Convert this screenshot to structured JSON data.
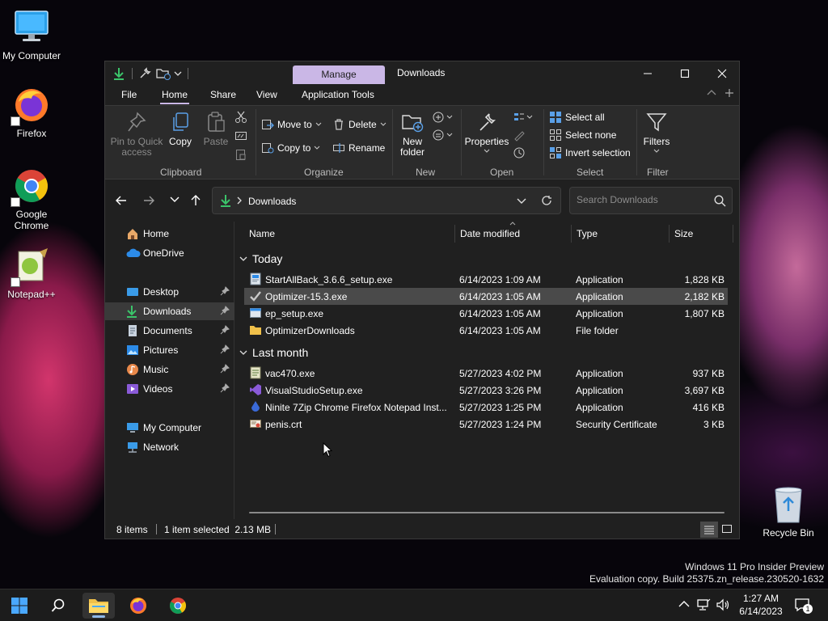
{
  "desktop": {
    "icons": [
      {
        "label": "My Computer"
      },
      {
        "label": "Firefox"
      },
      {
        "label": "Google Chrome"
      },
      {
        "label": "Notepad++"
      },
      {
        "label": "Recycle Bin"
      }
    ],
    "watermark_line1": "Windows 11 Pro Insider Preview",
    "watermark_line2": "Evaluation copy. Build 25375.zn_release.230520-1632"
  },
  "window": {
    "context_tab": "Manage",
    "title": "Downloads",
    "menu": [
      "File",
      "Home",
      "Share",
      "View",
      "Application Tools"
    ],
    "active_menu": "Home",
    "ribbon": {
      "pin_label_1": "Pin to Quick",
      "pin_label_2": "access",
      "copy": "Copy",
      "paste": "Paste",
      "clipboard": "Clipboard",
      "move_to": "Move to",
      "copy_to": "Copy to",
      "delete": "Delete",
      "rename": "Rename",
      "organize": "Organize",
      "new_folder_1": "New",
      "new_folder_2": "folder",
      "new": "New",
      "properties": "Properties",
      "open": "Open",
      "select_all": "Select all",
      "select_none": "Select none",
      "invert_selection": "Invert selection",
      "select": "Select",
      "filters": "Filters",
      "filter": "Filter"
    },
    "address": {
      "location": "Downloads",
      "search_placeholder": "Search Downloads"
    },
    "nav": [
      {
        "label": "Home"
      },
      {
        "label": "OneDrive"
      },
      {
        "label": "Desktop"
      },
      {
        "label": "Downloads"
      },
      {
        "label": "Documents"
      },
      {
        "label": "Pictures"
      },
      {
        "label": "Music"
      },
      {
        "label": "Videos"
      },
      {
        "label": "My Computer"
      },
      {
        "label": "Network"
      }
    ],
    "columns": {
      "name": "Name",
      "date": "Date modified",
      "type": "Type",
      "size": "Size"
    },
    "groups": {
      "today": "Today",
      "last_month": "Last month"
    },
    "files": [
      {
        "name": "StartAllBack_3.6.6_setup.exe",
        "date": "6/14/2023 1:09 AM",
        "type": "Application",
        "size": "1,828 KB"
      },
      {
        "name": "Optimizer-15.3.exe",
        "date": "6/14/2023 1:05 AM",
        "type": "Application",
        "size": "2,182 KB"
      },
      {
        "name": "ep_setup.exe",
        "date": "6/14/2023 1:05 AM",
        "type": "Application",
        "size": "1,807 KB"
      },
      {
        "name": "OptimizerDownloads",
        "date": "6/14/2023 1:05 AM",
        "type": "File folder",
        "size": ""
      },
      {
        "name": "vac470.exe",
        "date": "5/27/2023 4:02 PM",
        "type": "Application",
        "size": "937 KB"
      },
      {
        "name": "VisualStudioSetup.exe",
        "date": "5/27/2023 3:26 PM",
        "type": "Application",
        "size": "3,697 KB"
      },
      {
        "name": "Ninite 7Zip Chrome Firefox Notepad Inst...",
        "date": "5/27/2023 1:25 PM",
        "type": "Application",
        "size": "416 KB"
      },
      {
        "name": "penis.crt",
        "date": "5/27/2023 1:24 PM",
        "type": "Security Certificate",
        "size": "3 KB"
      }
    ],
    "status": {
      "count": "8 items",
      "selection": "1 item selected  2.13 MB"
    }
  },
  "taskbar": {
    "time": "1:27 AM",
    "date": "6/14/2023",
    "notifications": "1"
  },
  "colors": {
    "accent": "#cab7e6",
    "window_bg": "#202020",
    "ribbon_bg": "#2b2b2b",
    "selection": "#4a4a4a"
  }
}
